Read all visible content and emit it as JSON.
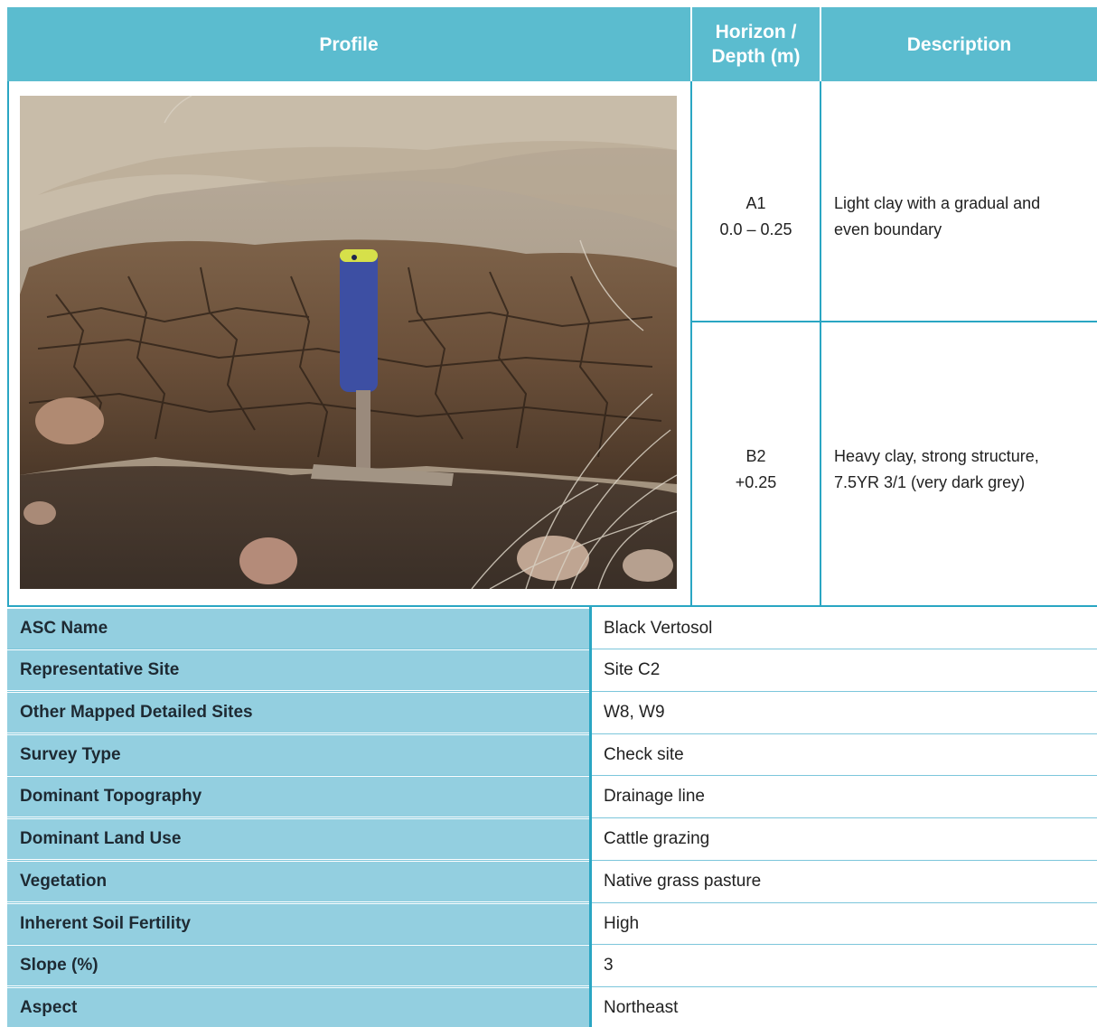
{
  "header": {
    "profile": "Profile",
    "horizon_line1": "Horizon /",
    "horizon_line2": "Depth (m)",
    "description": "Description"
  },
  "horizons": [
    {
      "name": "A1",
      "depth": "0.0 – 0.25",
      "description_line1": "Light clay with a gradual and",
      "description_line2": "even boundary"
    },
    {
      "name": "B2",
      "depth": "+0.25",
      "description_line1": "Heavy clay, strong structure,",
      "description_line2": "7.5YR 3/1 (very dark grey)"
    }
  ],
  "properties": [
    {
      "label": "ASC Name",
      "value": "Black Vertosol"
    },
    {
      "label": "Representative Site",
      "value": "Site C2"
    },
    {
      "label": "Other Mapped Detailed Sites",
      "value": "W8, W9"
    },
    {
      "label": "Survey Type",
      "value": "Check site"
    },
    {
      "label": "Dominant Topography",
      "value": "Drainage line"
    },
    {
      "label": "Dominant Land Use",
      "value": "Cattle grazing"
    },
    {
      "label": "Vegetation",
      "value": "Native grass pasture"
    },
    {
      "label": "Inherent Soil Fertility",
      "value": "High"
    },
    {
      "label": "Slope (%)",
      "value": "3"
    },
    {
      "label": "Aspect",
      "value": "Northeast"
    }
  ],
  "colors": {
    "header_bg": "#5bbccf",
    "label_bg": "#93cfe0",
    "border": "#2aa6c3"
  }
}
